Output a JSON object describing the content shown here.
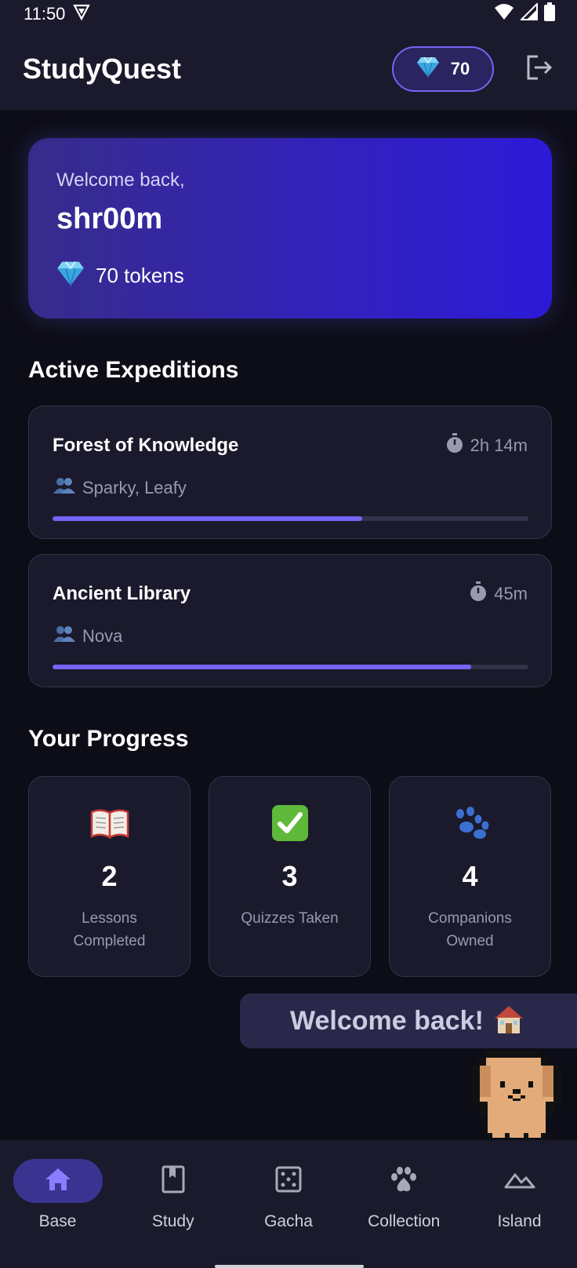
{
  "status_bar": {
    "time": "11:50"
  },
  "app": {
    "title": "StudyQuest",
    "token_count": "70"
  },
  "welcome": {
    "greeting": "Welcome back,",
    "username": "shr00m",
    "tokens": "70 tokens"
  },
  "expeditions": {
    "title": "Active Expeditions",
    "items": [
      {
        "name": "Forest of Knowledge",
        "time": "2h 14m",
        "members": "Sparky, Leafy",
        "progress": 0.65
      },
      {
        "name": "Ancient Library",
        "time": "45m",
        "members": "Nova",
        "progress": 0.88
      }
    ]
  },
  "progress": {
    "title": "Your Progress",
    "tiles": [
      {
        "icon": "book-icon",
        "value": "2",
        "label": "Lessons Completed"
      },
      {
        "icon": "checkmark-icon",
        "value": "3",
        "label": "Quizzes Taken"
      },
      {
        "icon": "paw-icon",
        "value": "4",
        "label": "Companions Owned"
      }
    ]
  },
  "toast": {
    "text": "Welcome back!"
  },
  "nav": {
    "items": [
      {
        "label": "Base",
        "icon": "home-icon",
        "active": true
      },
      {
        "label": "Study",
        "icon": "book-bookmark-icon",
        "active": false
      },
      {
        "label": "Gacha",
        "icon": "dice-icon",
        "active": false
      },
      {
        "label": "Collection",
        "icon": "paw-icon",
        "active": false
      },
      {
        "label": "Island",
        "icon": "mountain-icon",
        "active": false
      }
    ]
  },
  "colors": {
    "accent": "#7565f5",
    "surface": "#1a1a2c",
    "background": "#0d0d17"
  }
}
